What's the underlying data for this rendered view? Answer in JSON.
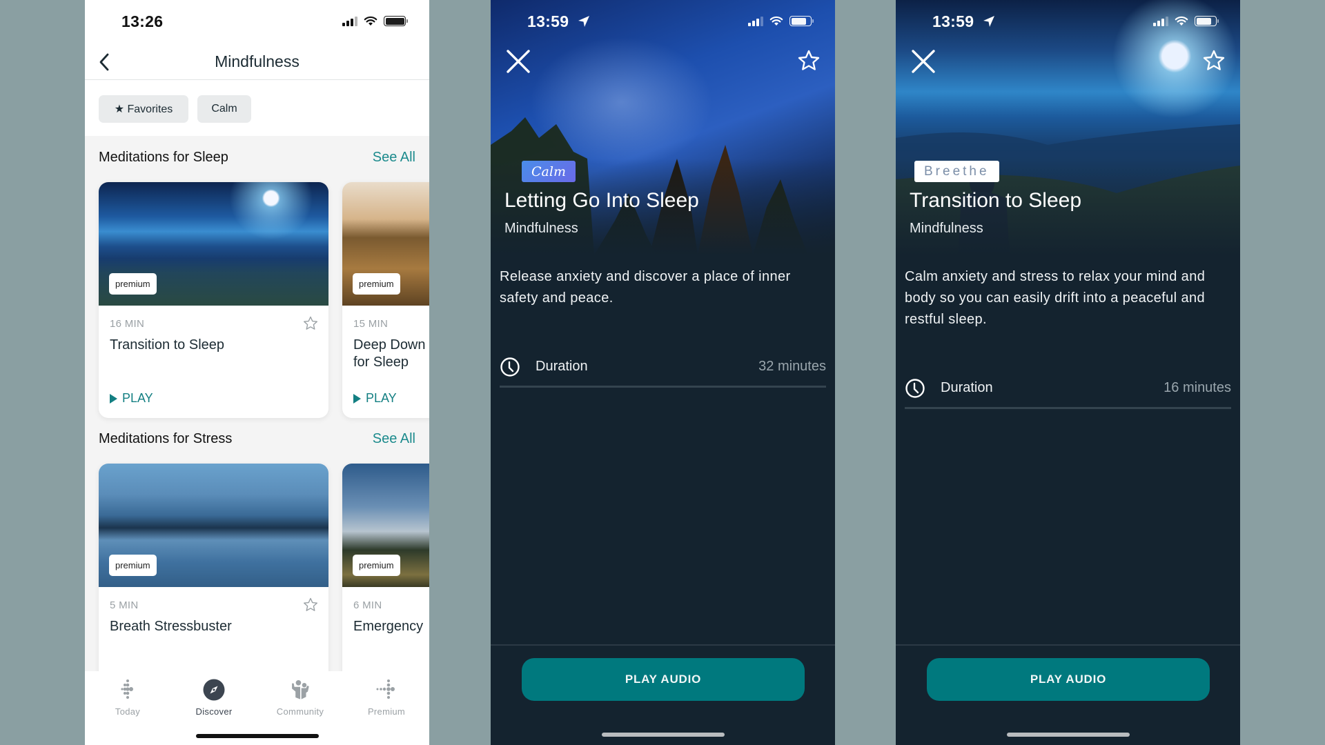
{
  "left": {
    "status": {
      "time": "13:26"
    },
    "header": {
      "title": "Mindfulness",
      "back_icon": "chevron-left-icon"
    },
    "filters": [
      {
        "label": "★ Favorites",
        "icon": "star-icon"
      },
      {
        "label": "Calm"
      }
    ],
    "sections": [
      {
        "title": "Meditations for Sleep",
        "see_all": "See All",
        "cards": [
          {
            "badge": "premium",
            "duration": "16 MIN",
            "title": "Transition to Sleep",
            "play": "PLAY"
          },
          {
            "badge": "premium",
            "duration": "15 MIN",
            "title": "Deep Down for Sleep",
            "play": "PLAY"
          }
        ]
      },
      {
        "title": "Meditations for Stress",
        "see_all": "See All",
        "cards": [
          {
            "badge": "premium",
            "duration": "5 MIN",
            "title": "Breath Stressbuster"
          },
          {
            "badge": "premium",
            "duration": "6 MIN",
            "title": "Emergency"
          }
        ]
      }
    ],
    "tabs": [
      {
        "label": "Today",
        "icon": "fitbit-dots-icon",
        "active": false
      },
      {
        "label": "Discover",
        "icon": "compass-icon",
        "active": true
      },
      {
        "label": "Community",
        "icon": "community-icon",
        "active": false
      },
      {
        "label": "Premium",
        "icon": "premium-dots-icon",
        "active": false
      }
    ]
  },
  "middle": {
    "status": {
      "time": "13:59"
    },
    "source_badge": "Calm",
    "title": "Letting Go Into Sleep",
    "category": "Mindfulness",
    "description": "Release anxiety and discover a place of inner safety and peace.",
    "duration_label": "Duration",
    "duration_value": "32 minutes",
    "play_button": "PLAY AUDIO"
  },
  "right": {
    "status": {
      "time": "13:59"
    },
    "source_badge": "Breethe",
    "title": "Transition to Sleep",
    "category": "Mindfulness",
    "description": "Calm anxiety and stress to relax your mind and body so you can easily drift into a peaceful and restful sleep.",
    "duration_label": "Duration",
    "duration_value": "16 minutes",
    "play_button": "PLAY AUDIO"
  },
  "colors": {
    "accent_teal": "#137f82",
    "play_button": "#00797e",
    "detail_background": "#14232f",
    "backdrop": "#8a9fa2"
  }
}
